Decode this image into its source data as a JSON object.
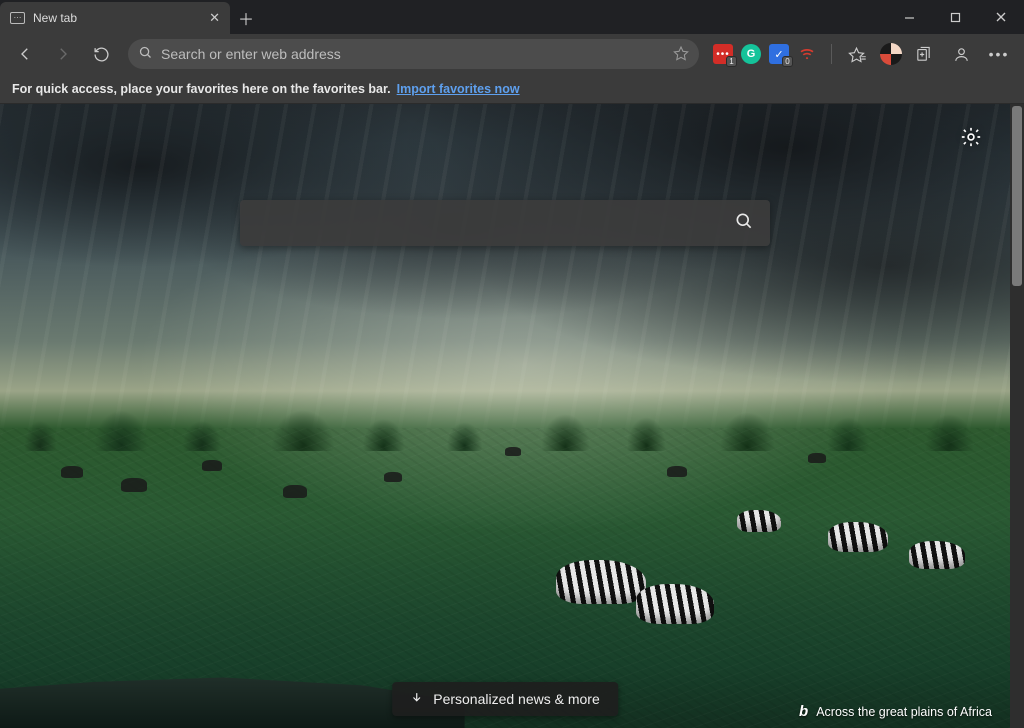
{
  "tab": {
    "title": "New tab"
  },
  "toolbar": {
    "address_placeholder": "Search or enter web address",
    "extensions": [
      {
        "name": "lastpass-extension",
        "bg": "#d32d27",
        "dots": true,
        "badge": "1"
      },
      {
        "name": "grammarly-extension",
        "bg": "#15c39a",
        "letter": "G",
        "round": true
      },
      {
        "name": "todo-extension",
        "bg": "#2f6fe0",
        "emoji": "✓",
        "badge": "0"
      },
      {
        "name": "vpn-extension",
        "bg": "transparent",
        "wifi": true,
        "color": "#d53b2f"
      }
    ]
  },
  "infobar": {
    "text": "For quick access, place your favorites here on the favorites bar.",
    "link": "Import favorites now"
  },
  "ntp": {
    "news_button": "Personalized news & more",
    "credit": "Across the great plains of Africa"
  }
}
